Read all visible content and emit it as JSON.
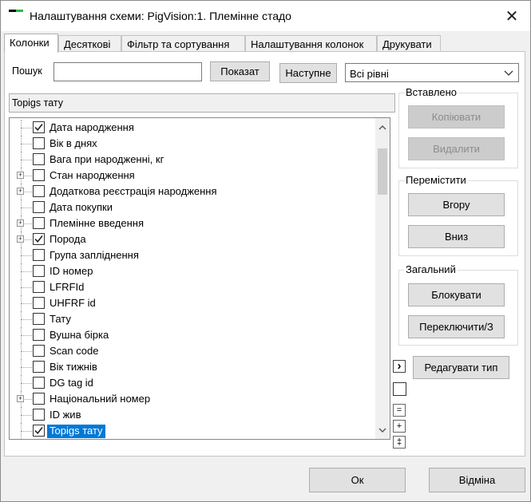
{
  "window": {
    "title": "Налаштування схеми: PigVision:1. Племінне стадо",
    "close_glyph": "✕"
  },
  "tabs": [
    {
      "label": "Колонки",
      "active": true
    },
    {
      "label": "Десяткові",
      "active": false
    },
    {
      "label": "Фільтр та сортування",
      "active": false
    },
    {
      "label": "Налаштування колонок",
      "active": false
    },
    {
      "label": "Друкувати",
      "active": false
    }
  ],
  "search": {
    "label": "Пошук",
    "value": "",
    "show_button": "Показат",
    "next_button": "Наступне",
    "level_select": "Всі рівні"
  },
  "tree": {
    "header": "Topigs тату",
    "items": [
      {
        "label": "Дата народження",
        "checked": true,
        "expandable": false,
        "selected": false
      },
      {
        "label": "Вік в днях",
        "checked": false,
        "expandable": false,
        "selected": false
      },
      {
        "label": "Вага при народженні, кг",
        "checked": false,
        "expandable": false,
        "selected": false
      },
      {
        "label": "Стан народження",
        "checked": false,
        "expandable": true,
        "selected": false
      },
      {
        "label": "Додаткова реєстрація народження",
        "checked": false,
        "expandable": true,
        "selected": false
      },
      {
        "label": "Дата покупки",
        "checked": false,
        "expandable": false,
        "selected": false
      },
      {
        "label": "Племінне введення",
        "checked": false,
        "expandable": true,
        "selected": false
      },
      {
        "label": "Порода",
        "checked": true,
        "expandable": true,
        "selected": false
      },
      {
        "label": "Група запліднення",
        "checked": false,
        "expandable": false,
        "selected": false
      },
      {
        "label": "ID номер",
        "checked": false,
        "expandable": false,
        "selected": false
      },
      {
        "label": "LFRFId",
        "checked": false,
        "expandable": false,
        "selected": false
      },
      {
        "label": "UHFRF id",
        "checked": false,
        "expandable": false,
        "selected": false
      },
      {
        "label": "Тату",
        "checked": false,
        "expandable": false,
        "selected": false
      },
      {
        "label": "Вушна бірка",
        "checked": false,
        "expandable": false,
        "selected": false
      },
      {
        "label": "Scan code",
        "checked": false,
        "expandable": false,
        "selected": false
      },
      {
        "label": "Вік тижнів",
        "checked": false,
        "expandable": false,
        "selected": false
      },
      {
        "label": "DG tag id",
        "checked": false,
        "expandable": false,
        "selected": false
      },
      {
        "label": "Національний номер",
        "checked": false,
        "expandable": true,
        "selected": false
      },
      {
        "label": "ID жив",
        "checked": false,
        "expandable": false,
        "selected": false
      },
      {
        "label": "Topigs тату",
        "checked": true,
        "expandable": false,
        "selected": true
      }
    ]
  },
  "side_tools": {
    "arrow": "›",
    "minus": "=",
    "plus": "+",
    "double": "‡"
  },
  "groups": {
    "inserted": {
      "title": "Вставлено",
      "copy": "Копіювати",
      "delete": "Видалити"
    },
    "move": {
      "title": "Перемістити",
      "up": "Вгору",
      "down": "Вниз"
    },
    "general": {
      "title": "Загальний",
      "lock": "Блокувати",
      "switch": "Переключити/З"
    },
    "edit_type": "Редагувати тип"
  },
  "footer": {
    "ok": "Ок",
    "cancel": "Відміна"
  },
  "colors": {
    "selection": "#0078d7",
    "accent_green": "#2db84a"
  }
}
